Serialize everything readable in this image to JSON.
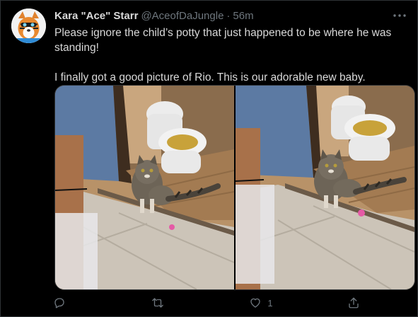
{
  "author": {
    "name": "Kara \"Ace\" Starr",
    "handle": "@AceofDaJungle",
    "separator": "·",
    "time": "56m"
  },
  "tweet": {
    "paragraphs": [
      "Please ignore the child’s potty that just happened to be where he was standing!",
      "I finally got a good picture of Rio. This is our adorable new baby."
    ]
  },
  "media": {
    "count": 2
  },
  "actions": {
    "reply_count": "",
    "retweet_count": "",
    "like_count": "1",
    "share_count": ""
  },
  "icons": {
    "more": "more-dots-icon",
    "reply": "reply-icon",
    "retweet": "retweet-icon",
    "like": "heart-icon",
    "share": "share-icon"
  },
  "colors": {
    "background": "#000000",
    "text": "#d9d9d9",
    "muted": "#6e767d",
    "border": "#2f3336"
  }
}
